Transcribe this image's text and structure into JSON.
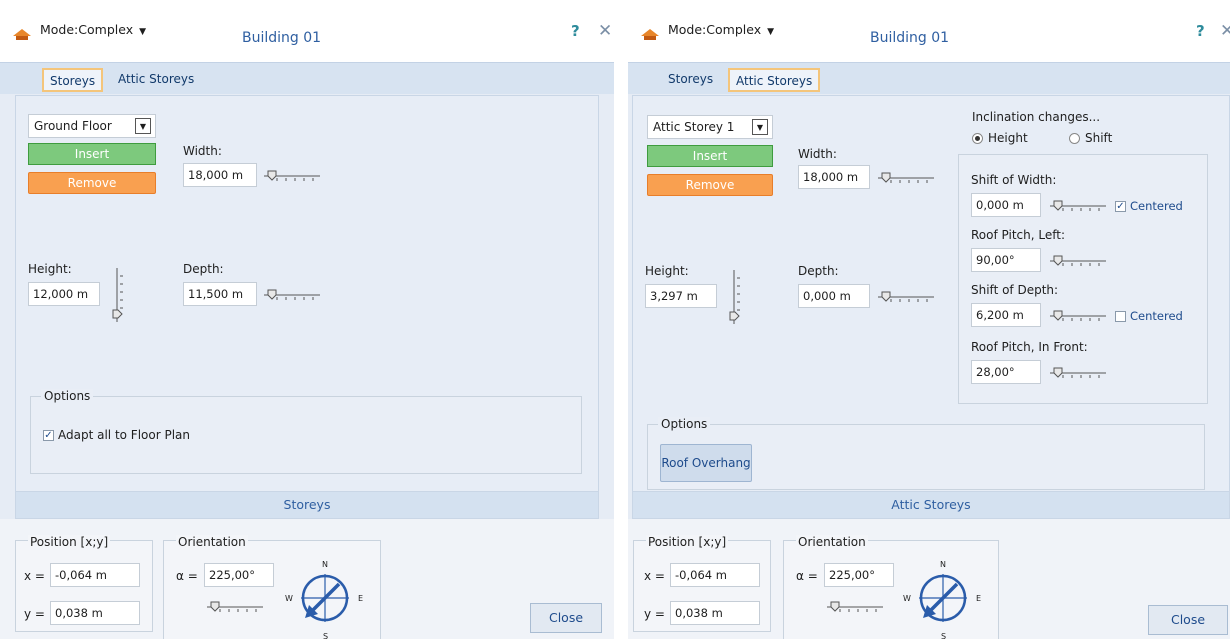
{
  "left": {
    "mode": "Mode:Complex",
    "title": "Building 01",
    "help": "?",
    "close": "✕",
    "tabs": [
      "Storeys",
      "Attic Storeys"
    ],
    "active_tab": "Storeys",
    "floor_select": "Ground Floor",
    "insert": "Insert",
    "remove": "Remove",
    "width_label": "Width:",
    "width_value": "18,000 m",
    "height_label": "Height:",
    "height_value": "12,000 m",
    "depth_label": "Depth:",
    "depth_value": "11,500 m",
    "options_label": "Options",
    "adapt_label": "Adapt all to Floor Plan",
    "adapt_checked": true,
    "section_footer": "Storeys",
    "position_label": "Position [x;y]",
    "x_label": "x =",
    "x_value": "-0,064 m",
    "y_label": "y =",
    "y_value": "0,038 m",
    "orientation_label": "Orientation",
    "alpha_label": "α =",
    "alpha_value": "225,00°",
    "close_button": "Close",
    "compass": {
      "n": "N",
      "e": "E",
      "s": "S",
      "w": "W"
    }
  },
  "right": {
    "mode": "Mode:Complex",
    "title": "Building 01",
    "help": "?",
    "close": "✕",
    "tabs": [
      "Storeys",
      "Attic Storeys"
    ],
    "active_tab": "Attic Storeys",
    "storey_select": "Attic Storey 1",
    "insert": "Insert",
    "remove": "Remove",
    "width_label": "Width:",
    "width_value": "18,000 m",
    "height_label": "Height:",
    "height_value": "3,297 m",
    "depth_label": "Depth:",
    "depth_value": "0,000 m",
    "inclination_label": "Inclination changes...",
    "radio_height": "Height",
    "radio_shift": "Shift",
    "radio_selected": "Height",
    "shift_width_label": "Shift of Width:",
    "shift_width_value": "0,000 m",
    "centered_label": "Centered",
    "shift_width_centered": true,
    "roof_left_label": "Roof Pitch, Left:",
    "roof_left_value": "90,00°",
    "shift_depth_label": "Shift of Depth:",
    "shift_depth_value": "6,200 m",
    "shift_depth_centered": false,
    "roof_front_label": "Roof Pitch, In Front:",
    "roof_front_value": "28,00°",
    "options_label": "Options",
    "roof_overhang": "Roof Overhang",
    "section_footer": "Attic Storeys",
    "position_label": "Position [x;y]",
    "x_label": "x =",
    "x_value": "-0,064 m",
    "y_label": "y =",
    "y_value": "0,038 m",
    "orientation_label": "Orientation",
    "alpha_label": "α =",
    "alpha_value": "225,00°",
    "close_button": "Close",
    "compass": {
      "n": "N",
      "e": "E",
      "s": "S",
      "w": "W"
    }
  },
  "colors": {
    "title_blue": "#2f5fa1",
    "insert_green": "#7dc97d",
    "remove_orange": "#f9a050",
    "active_tab_border": "#f4c57b",
    "compass_blue": "#2a5caa"
  }
}
